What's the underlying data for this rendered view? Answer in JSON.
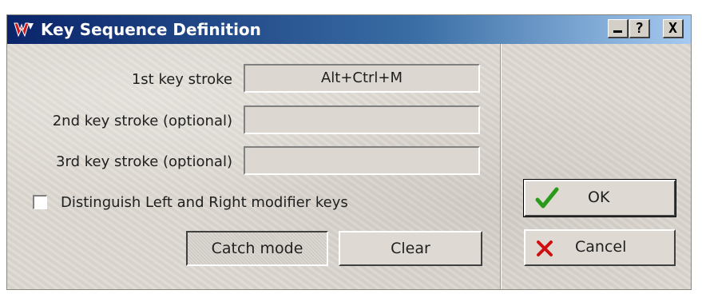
{
  "window": {
    "title": "Key Sequence Definition",
    "controls": {
      "minimize": "_",
      "help": "?",
      "close": "X"
    }
  },
  "fields": [
    {
      "label": "1st key stroke",
      "value": "Alt+Ctrl+M"
    },
    {
      "label": "2nd key stroke (optional)",
      "value": ""
    },
    {
      "label": "3rd key stroke (optional)",
      "value": ""
    }
  ],
  "options": {
    "distinguish_label": "Distinguish Left and Right modifier keys",
    "distinguish_checked": false
  },
  "buttons": {
    "catch_mode": "Catch mode",
    "catch_mode_pressed": true,
    "clear": "Clear",
    "ok": "OK",
    "cancel": "Cancel"
  },
  "colors": {
    "title_gradient_start": "#0a246a",
    "ok_check": "#2a9a1a",
    "cancel_x": "#d01010",
    "logo_red": "#cc1a1a"
  }
}
